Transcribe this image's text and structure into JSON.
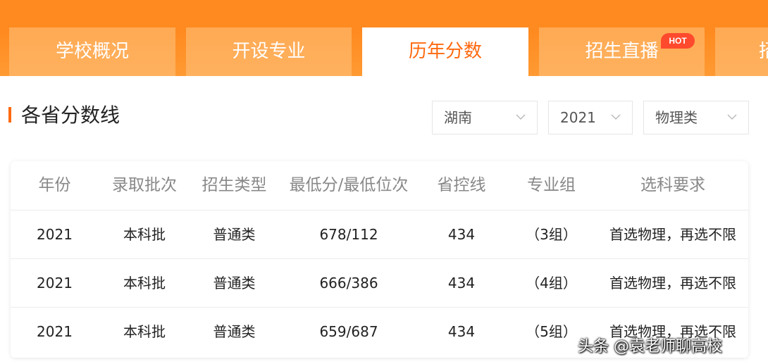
{
  "tabs": [
    {
      "label": "学校概况",
      "active": false
    },
    {
      "label": "开设专业",
      "active": false
    },
    {
      "label": "历年分数",
      "active": true
    },
    {
      "label": "招生直播",
      "active": false,
      "badge": "HOT"
    },
    {
      "label": "招",
      "active": false
    }
  ],
  "section": {
    "title": "各省分数线"
  },
  "filters": {
    "province": "湖南",
    "year": "2021",
    "subject": "物理类"
  },
  "table": {
    "columns": [
      "年份",
      "录取批次",
      "招生类型",
      "最低分/最低位次",
      "省控线",
      "专业组",
      "选科要求"
    ],
    "rows": [
      [
        "2021",
        "本科批",
        "普通类",
        "678/112",
        "434",
        "（3组）",
        "首选物理，再选不限"
      ],
      [
        "2021",
        "本科批",
        "普通类",
        "666/386",
        "434",
        "（4组）",
        "首选物理，再选不限"
      ],
      [
        "2021",
        "本科批",
        "普通类",
        "659/687",
        "434",
        "（5组）",
        "首选物理，再选不限"
      ]
    ]
  },
  "watermark": "头条 @袁老师聊高校",
  "colors": {
    "accent": "#ff6a10",
    "band": "#ff8a1f",
    "hot_badge": "#ff4a2d"
  }
}
